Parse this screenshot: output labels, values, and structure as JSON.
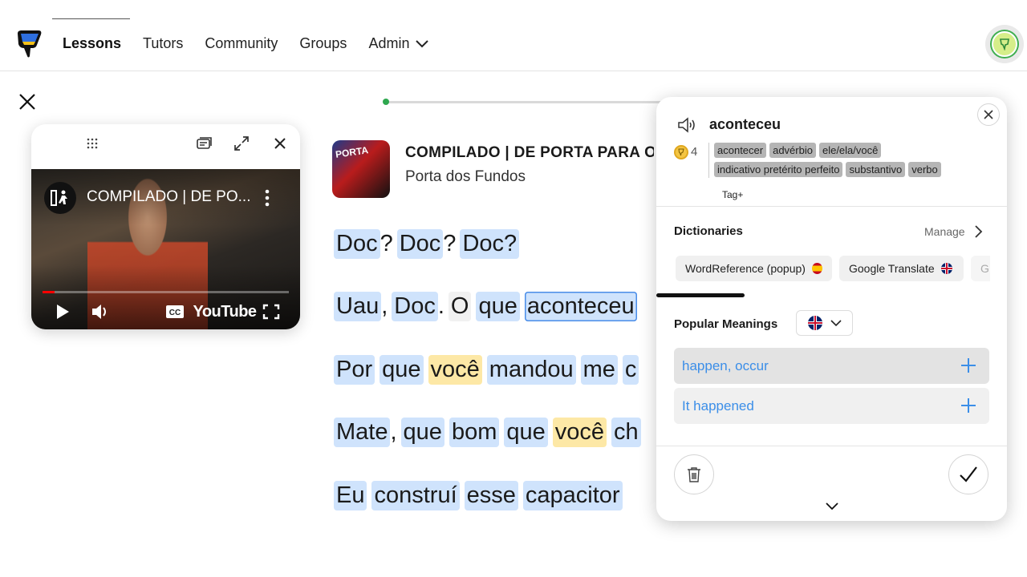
{
  "nav": {
    "items": [
      {
        "label": "Lessons",
        "active": true
      },
      {
        "label": "Tutors"
      },
      {
        "label": "Community"
      },
      {
        "label": "Groups"
      },
      {
        "label": "Admin"
      }
    ]
  },
  "lesson": {
    "progress": 0.01,
    "title": "COMPILADO | DE PORTA PARA O F",
    "channel": "Porta dos Fundos",
    "thumb_text": "PORTA"
  },
  "video": {
    "title": "COMPILADO | DE PO...",
    "logo": "YouTube",
    "progress": 0.05,
    "icons": [
      "drag-handle-icon",
      "captions-toggle-icon",
      "expand-icon",
      "close-icon",
      "play-icon",
      "volume-icon",
      "cc-icon",
      "fullscreen-icon"
    ]
  },
  "transcript": {
    "lines": [
      [
        {
          "t": "Doc",
          "c": "blue"
        },
        {
          "t": "?",
          "c": "p"
        },
        {
          "t": "Doc",
          "c": "blue"
        },
        {
          "t": "?",
          "c": "p"
        },
        {
          "t": "Doc?",
          "c": "blue"
        }
      ],
      [
        {
          "t": "Uau",
          "c": "blue"
        },
        {
          "t": ",",
          "c": "p"
        },
        {
          "t": "Doc",
          "c": "blue"
        },
        {
          "t": ".",
          "c": "p"
        },
        {
          "t": "O",
          "c": "grey"
        },
        {
          "t": "que",
          "c": "blue"
        },
        {
          "t": "aconteceu",
          "c": "sel"
        }
      ],
      [
        {
          "t": "Por",
          "c": "blue"
        },
        {
          "t": "que",
          "c": "blue"
        },
        {
          "t": "você",
          "c": "yellow"
        },
        {
          "t": "mandou",
          "c": "blue"
        },
        {
          "t": "me",
          "c": "blue"
        },
        {
          "t": "c",
          "c": "blue"
        }
      ],
      [
        {
          "t": "Mate",
          "c": "blue"
        },
        {
          "t": ",",
          "c": "p"
        },
        {
          "t": "que",
          "c": "blue"
        },
        {
          "t": "bom",
          "c": "blue"
        },
        {
          "t": "que",
          "c": "blue"
        },
        {
          "t": "você",
          "c": "yellow"
        },
        {
          "t": "ch",
          "c": "blue"
        }
      ],
      [
        {
          "t": "Eu",
          "c": "blue"
        },
        {
          "t": "construí",
          "c": "blue"
        },
        {
          "t": "esse",
          "c": "blue"
        },
        {
          "t": "capacitor",
          "c": "blue"
        }
      ]
    ]
  },
  "panel": {
    "term": "aconteceu",
    "status": "4",
    "tags": [
      "acontecer",
      "advérbio",
      "ele/ela/você",
      "indicativo pretérito perfeito",
      "substantivo",
      "verbo"
    ],
    "tag_add": "Tag+",
    "dictionaries_title": "Dictionaries",
    "manage": "Manage",
    "dictionaries": [
      {
        "label": "WordReference (popup)",
        "flag": "es"
      },
      {
        "label": "Google Translate",
        "flag": "uk"
      },
      {
        "label": "G",
        "flag": ""
      }
    ],
    "popular_title": "Popular Meanings",
    "language": "English",
    "meanings": [
      "happen, occur",
      "It happened"
    ]
  },
  "colors": {
    "word_blue": "#cfe3fc",
    "word_yellow": "#fde8a6",
    "link_blue": "#3b8ee8",
    "progress_green": "#2fa84f"
  }
}
